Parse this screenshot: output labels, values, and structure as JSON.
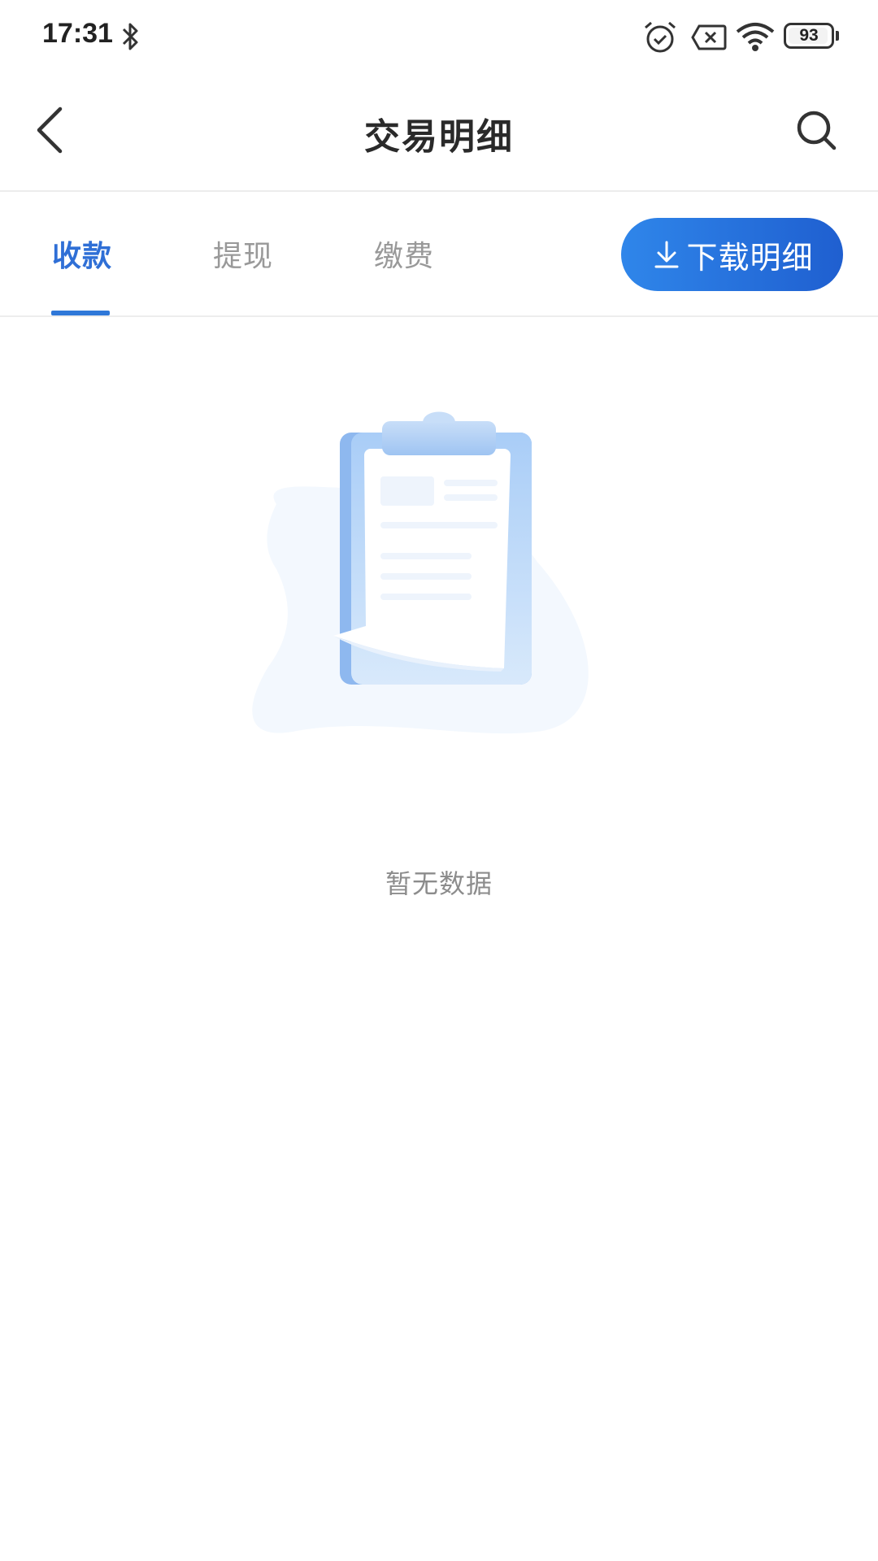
{
  "status_bar": {
    "time": "17:31",
    "battery_level": "93",
    "icons": [
      "bluetooth-icon",
      "alarm-icon",
      "sim-off-icon",
      "wifi-icon",
      "battery-icon"
    ]
  },
  "nav": {
    "title": "交易明细",
    "back_icon": "chevron-left-icon",
    "search_icon": "search-icon"
  },
  "tabs": [
    {
      "label": "收款",
      "active": true
    },
    {
      "label": "提现",
      "active": false
    },
    {
      "label": "缴费",
      "active": false
    }
  ],
  "download": {
    "label": "下载明细",
    "icon": "download-icon"
  },
  "empty_state": {
    "message": "暂无数据",
    "illustration": "clipboard-empty-illustration"
  },
  "colors": {
    "accent": "#2f6fd6",
    "button_gradient_start": "#2f86ea",
    "button_gradient_end": "#1f5fd0",
    "inactive_tab": "#999999",
    "empty_text": "#8c8c8c"
  }
}
